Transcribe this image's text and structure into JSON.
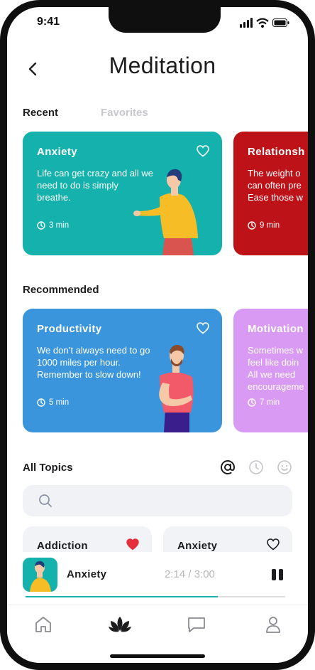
{
  "status_bar": {
    "time": "9:41"
  },
  "header": {
    "title": "Meditation"
  },
  "tabs": [
    {
      "label": "Recent",
      "active": true
    },
    {
      "label": "Favorites",
      "active": false
    }
  ],
  "recent_cards": [
    {
      "title": "Anxiety",
      "description": "Life can get crazy and all we need to do is simply breathe.",
      "duration": "3 min",
      "color": "#15b1ac",
      "favorited": false
    },
    {
      "title": "Relationsh",
      "description": "The weight o can often pre Ease those w",
      "duration": "9 min",
      "color": "#bd1218",
      "favorited": false
    }
  ],
  "recommended": {
    "label": "Recommended",
    "cards": [
      {
        "title": "Productivity",
        "description": "We don’t always need to go 1000 miles per hour. Remember to slow down!",
        "duration": "5 min",
        "color": "#3a95dd",
        "favorited": false
      },
      {
        "title": "Motivation",
        "description": "Sometimes w feel like doin All we need encourageme",
        "duration": "7 min",
        "color": "#d99af4",
        "favorited": false
      }
    ]
  },
  "topics": {
    "label": "All Topics",
    "search_placeholder": "",
    "items": [
      {
        "label": "Addiction",
        "favorited": true
      },
      {
        "label": "Anxiety",
        "favorited": false
      }
    ]
  },
  "player": {
    "title": "Anxiety",
    "time": "2:14 / 3:00",
    "progress": 0.74,
    "accent": "#15b1ac"
  },
  "icons": {
    "back": "chevron-left-icon",
    "heart": "heart-icon",
    "clock": "clock-icon",
    "at": "at-icon",
    "smile": "smile-icon",
    "search": "search-icon",
    "pause": "pause-icon",
    "home": "home-icon",
    "lotus": "lotus-icon",
    "chat": "chat-icon",
    "profile": "profile-icon"
  }
}
